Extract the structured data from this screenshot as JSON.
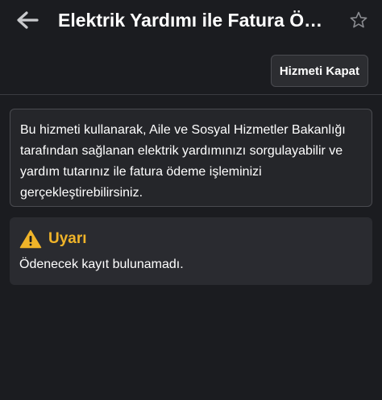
{
  "header": {
    "title": "Elektrik Yardımı ile Fatura Ödeme",
    "back_icon": "back-arrow-icon",
    "favorite_icon": "star-outline-icon"
  },
  "toolbar": {
    "close_service_label": "Hizmeti Kapat"
  },
  "info": {
    "text": "Bu hizmeti kullanarak, Aile ve Sosyal Hizmetler Bakanlığı tarafından sağlanan elektrik yardımınızı sorgulayabilir ve yardım tutarınız ile fatura ödeme işleminizi gerçekleştirebilirsiniz."
  },
  "warning": {
    "icon": "warning-triangle-icon",
    "title": "Uyarı",
    "message": "Ödenecek kayıt bulunamadı."
  },
  "colors": {
    "background": "#1b1c20",
    "card": "#25262a",
    "warning_accent": "#f0b429"
  }
}
